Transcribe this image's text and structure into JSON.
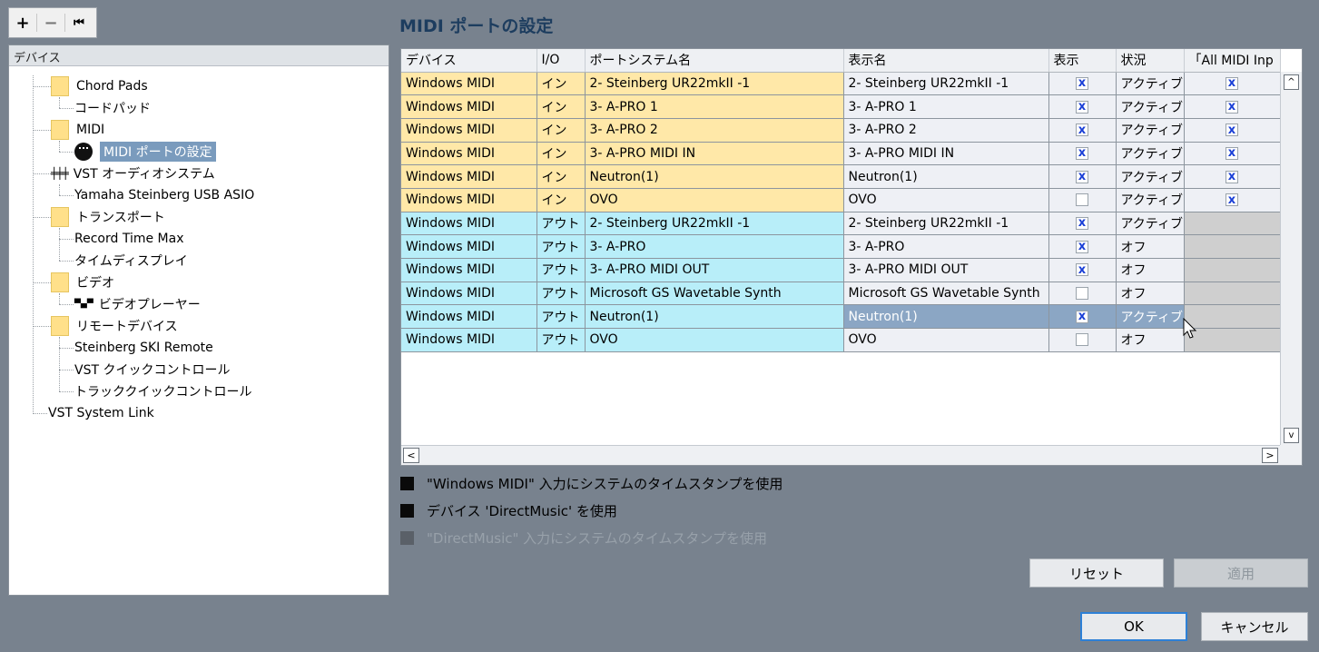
{
  "toolbar": {
    "add_label": "+",
    "remove_label": "−",
    "reset_label": "⏮"
  },
  "tree": {
    "header": "デバイス",
    "items": [
      {
        "label": "Chord Pads"
      },
      {
        "label": "コードパッド"
      },
      {
        "label": "MIDI"
      },
      {
        "label": "MIDI ポートの設定"
      },
      {
        "label": "VST オーディオシステム"
      },
      {
        "label": "Yamaha Steinberg USB ASIO"
      },
      {
        "label": "トランスポート"
      },
      {
        "label": "Record Time Max"
      },
      {
        "label": "タイムディスプレイ"
      },
      {
        "label": "ビデオ"
      },
      {
        "label": "ビデオプレーヤー"
      },
      {
        "label": "リモートデバイス"
      },
      {
        "label": "Steinberg SKI Remote"
      },
      {
        "label": "VST クイックコントロール"
      },
      {
        "label": "トラッククイックコントロール"
      },
      {
        "label": "VST System Link"
      }
    ]
  },
  "page_title": "MIDI ポートの設定",
  "table": {
    "columns": [
      "デバイス",
      "I/O",
      "ポートシステム名",
      "表示名",
      "表示",
      "状況",
      "「All MIDI Inp"
    ],
    "rows": [
      {
        "device": "Windows MIDI",
        "io": "イン",
        "port": "2- Steinberg UR22mkII -1",
        "display": "2- Steinberg UR22mkII -1",
        "show": "x",
        "status": "アクティブ",
        "all": "x"
      },
      {
        "device": "Windows MIDI",
        "io": "イン",
        "port": "3- A-PRO 1",
        "display": "3- A-PRO 1",
        "show": "x",
        "status": "アクティブ",
        "all": "x"
      },
      {
        "device": "Windows MIDI",
        "io": "イン",
        "port": "3- A-PRO 2",
        "display": "3- A-PRO 2",
        "show": "x",
        "status": "アクティブ",
        "all": "x"
      },
      {
        "device": "Windows MIDI",
        "io": "イン",
        "port": "3- A-PRO MIDI IN",
        "display": "3- A-PRO MIDI IN",
        "show": "x",
        "status": "アクティブ",
        "all": "x"
      },
      {
        "device": "Windows MIDI",
        "io": "イン",
        "port": "Neutron(1)",
        "display": "Neutron(1)",
        "show": "x",
        "status": "アクティブ",
        "all": "x"
      },
      {
        "device": "Windows MIDI",
        "io": "イン",
        "port": "OVO",
        "display": "OVO",
        "show": "",
        "status": "アクティブ",
        "all": "x"
      },
      {
        "device": "Windows MIDI",
        "io": "アウト",
        "port": "2- Steinberg UR22mkII -1",
        "display": "2- Steinberg UR22mkII -1",
        "show": "x",
        "status": "アクティブ",
        "all": ""
      },
      {
        "device": "Windows MIDI",
        "io": "アウト",
        "port": "3- A-PRO",
        "display": "3- A-PRO",
        "show": "x",
        "status": "オフ",
        "all": ""
      },
      {
        "device": "Windows MIDI",
        "io": "アウト",
        "port": "3- A-PRO MIDI OUT",
        "display": "3- A-PRO MIDI OUT",
        "show": "x",
        "status": "オフ",
        "all": ""
      },
      {
        "device": "Windows MIDI",
        "io": "アウト",
        "port": "Microsoft GS Wavetable Synth",
        "display": "Microsoft GS Wavetable Synth",
        "show": "",
        "status": "オフ",
        "all": ""
      },
      {
        "device": "Windows MIDI",
        "io": "アウト",
        "port": "Neutron(1)",
        "display": "Neutron(1)",
        "show": "x",
        "status": "アクティブ",
        "all": ""
      },
      {
        "device": "Windows MIDI",
        "io": "アウト",
        "port": "OVO",
        "display": "OVO",
        "show": "",
        "status": "オフ",
        "all": ""
      }
    ]
  },
  "options": {
    "opt1": "\"Windows MIDI\" 入力にシステムのタイムスタンプを使用",
    "opt2": "デバイス 'DirectMusic' を使用",
    "opt3": "\"DirectMusic\" 入力にシステムのタイムスタンプを使用"
  },
  "buttons": {
    "reset": "リセット",
    "apply": "適用",
    "ok": "OK",
    "cancel": "キャンセル"
  },
  "scroll": {
    "up": "^",
    "down": "v",
    "left": "<",
    "right": ">"
  }
}
